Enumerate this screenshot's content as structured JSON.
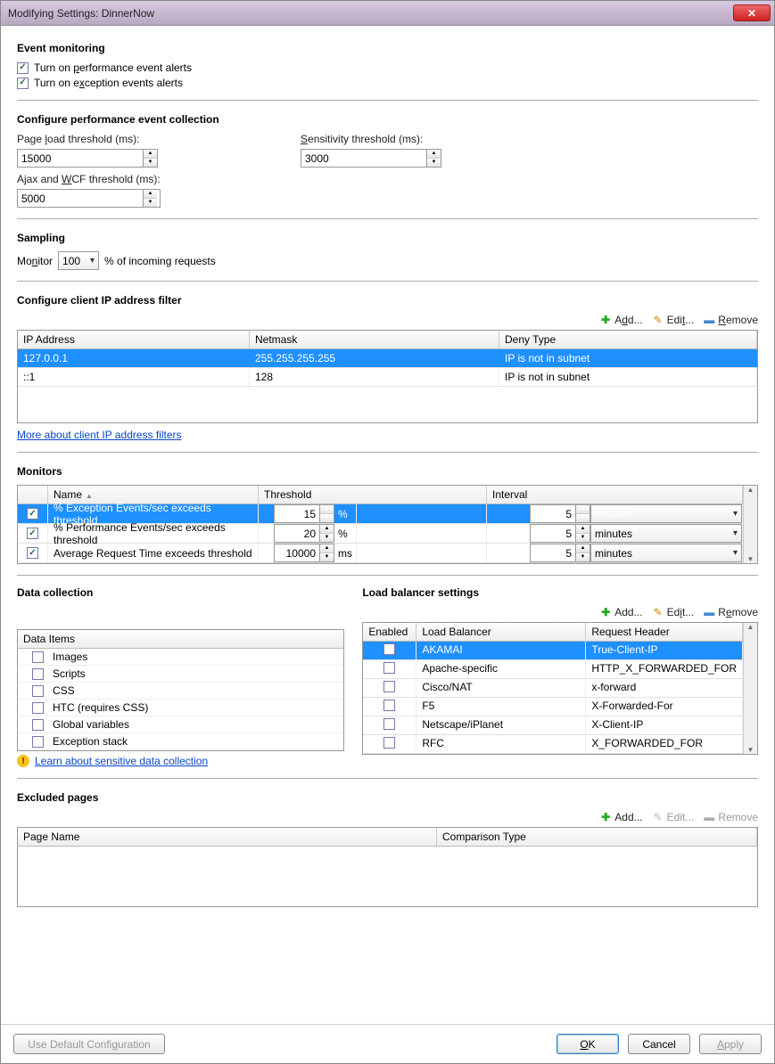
{
  "title": "Modifying Settings: DinnerNow",
  "eventMonitoring": {
    "heading": "Event monitoring",
    "perfAlerts": "Turn on performance event alerts",
    "excAlerts": "Turn on exception events alerts"
  },
  "perfCollection": {
    "heading": "Configure performance event collection",
    "pageLoadLabel": "Page load threshold (ms):",
    "pageLoadValue": "15000",
    "sensitivityLabel": "Sensitivity threshold (ms):",
    "sensitivityValue": "3000",
    "ajaxLabel": "Ajax and WCF threshold (ms):",
    "ajaxValue": "5000"
  },
  "sampling": {
    "heading": "Sampling",
    "monitorLabel": "Monitor",
    "percentValue": "100",
    "suffix": "% of incoming requests"
  },
  "ipFilter": {
    "heading": "Configure client IP address filter",
    "add": "Add...",
    "edit": "Edit...",
    "remove": "Remove",
    "cols": {
      "ip": "IP Address",
      "netmask": "Netmask",
      "deny": "Deny Type"
    },
    "rows": [
      {
        "ip": "127.0.0.1",
        "netmask": "255.255.255.255",
        "deny": "IP is not in subnet",
        "selected": true
      },
      {
        "ip": "::1",
        "netmask": "128",
        "deny": "IP is not in subnet",
        "selected": false
      }
    ],
    "link": "More about client IP address filters"
  },
  "monitors": {
    "heading": "Monitors",
    "cols": {
      "name": "Name",
      "threshold": "Threshold",
      "interval": "Interval"
    },
    "rows": [
      {
        "checked": true,
        "name": "% Exception Events/sec exceeds threshold",
        "threshold": "15",
        "unit": "%",
        "interval": "5",
        "intervalUnit": "minutes",
        "selected": true
      },
      {
        "checked": true,
        "name": "% Performance Events/sec exceeds threshold",
        "threshold": "20",
        "unit": "%",
        "interval": "5",
        "intervalUnit": "minutes",
        "selected": false
      },
      {
        "checked": true,
        "name": "Average Request Time exceeds threshold",
        "threshold": "10000",
        "unit": "ms",
        "interval": "5",
        "intervalUnit": "minutes",
        "selected": false
      }
    ]
  },
  "dataCollection": {
    "heading": "Data collection",
    "itemsHeader": "Data Items",
    "items": [
      "Images",
      "Scripts",
      "CSS",
      "HTC (requires CSS)",
      "Global variables",
      "Exception stack"
    ],
    "link": "Learn about sensitive data collection"
  },
  "loadBalancer": {
    "heading": "Load balancer settings",
    "add": "Add...",
    "edit": "Edit...",
    "remove": "Remove",
    "cols": {
      "enabled": "Enabled",
      "lb": "Load Balancer",
      "header": "Request Header"
    },
    "rows": [
      {
        "enabled": false,
        "lb": "AKAMAI",
        "header": "True-Client-IP",
        "selected": true
      },
      {
        "enabled": false,
        "lb": "Apache-specific",
        "header": "HTTP_X_FORWARDED_FOR",
        "selected": false
      },
      {
        "enabled": false,
        "lb": "Cisco/NAT",
        "header": "x-forward",
        "selected": false
      },
      {
        "enabled": false,
        "lb": "F5",
        "header": "X-Forwarded-For",
        "selected": false
      },
      {
        "enabled": false,
        "lb": "Netscape/iPlanet",
        "header": "X-Client-IP",
        "selected": false
      },
      {
        "enabled": false,
        "lb": "RFC",
        "header": "X_FORWARDED_FOR",
        "selected": false
      }
    ]
  },
  "excludedPages": {
    "heading": "Excluded pages",
    "add": "Add...",
    "edit": "Edit...",
    "remove": "Remove",
    "cols": {
      "page": "Page Name",
      "comp": "Comparison Type"
    }
  },
  "footer": {
    "useDefault": "Use Default Configuration",
    "ok": "OK",
    "cancel": "Cancel",
    "apply": "Apply"
  }
}
